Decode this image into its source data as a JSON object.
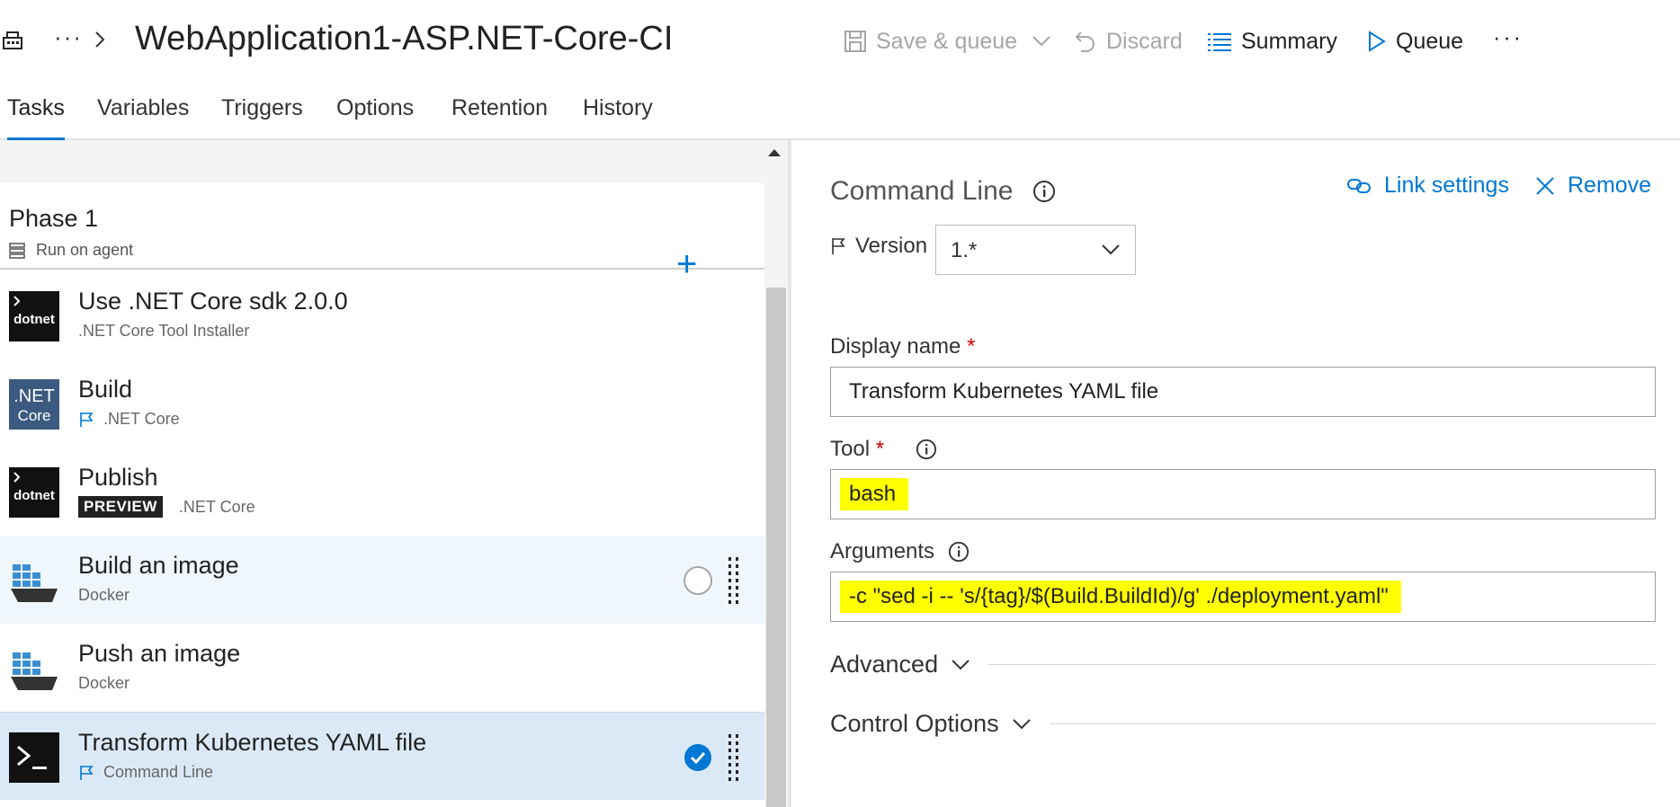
{
  "header": {
    "more_crumb": "···",
    "title": "WebApplication1-ASP.NET-Core-CI",
    "save_queue": "Save & queue",
    "discard": "Discard",
    "summary": "Summary",
    "queue": "Queue",
    "more": "···"
  },
  "tabs": [
    {
      "label": "Tasks"
    },
    {
      "label": "Variables"
    },
    {
      "label": "Triggers"
    },
    {
      "label": "Options"
    },
    {
      "label": "Retention"
    },
    {
      "label": "History"
    }
  ],
  "phase": {
    "title": "Phase 1",
    "subtitle": "Run on agent",
    "add": "+"
  },
  "tasks": [
    {
      "name": "Use .NET Core sdk 2.0.0",
      "sub": ".NET Core Tool Installer",
      "icon": "dotnet-icon"
    },
    {
      "name": "Build",
      "sub": ".NET Core",
      "icon": "dotnet-core-icon"
    },
    {
      "name": "Publish",
      "badge": "PREVIEW",
      "sub": ".NET Core",
      "icon": "dotnet-icon"
    },
    {
      "name": "Build an image",
      "sub": "Docker",
      "icon": "docker-icon"
    },
    {
      "name": "Push an image",
      "sub": "Docker",
      "icon": "docker-icon"
    },
    {
      "name": "Transform Kubernetes YAML file",
      "sub": "Command Line",
      "icon": "terminal-icon"
    }
  ],
  "icons": {
    "dotnet_text": "dotnet",
    "netcore_line1": ".NET",
    "netcore_line2": "Core"
  },
  "detail": {
    "title": "Command Line",
    "link_settings": "Link settings",
    "remove": "Remove",
    "version_label": "Version",
    "version_value": "1.*",
    "display_name_label": "Display name",
    "display_name_value": "Transform Kubernetes YAML file",
    "tool_label": "Tool",
    "tool_value": "bash",
    "arguments_label": "Arguments",
    "arguments_value": "-c \"sed -i -- 's/{tag}/$(Build.BuildId)/g' ./deployment.yaml\"",
    "required_mark": "*",
    "advanced": "Advanced",
    "control_options": "Control Options"
  },
  "colors": {
    "accent": "#0078d4",
    "highlight": "#ffff00",
    "selected_row": "#dbe9f6"
  }
}
